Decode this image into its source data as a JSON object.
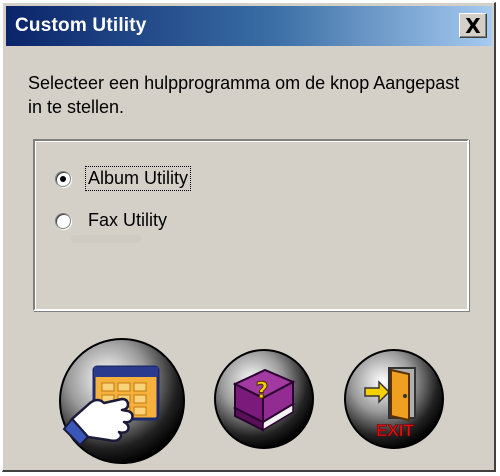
{
  "window": {
    "title": "Custom Utility",
    "close_glyph": "X"
  },
  "prompt": {
    "text": "Selecteer een hulpprogramma om de knop Aangepast in te stellen."
  },
  "options": {
    "items": [
      {
        "label": "Album Utility",
        "selected": true
      },
      {
        "label": "Fax Utility",
        "selected": false
      }
    ]
  },
  "buttons": {
    "album_icon": "hand-keypad-icon",
    "help_icon": "help-book-icon",
    "exit_icon": "exit-door-icon",
    "exit_text": "EXIT"
  },
  "colors": {
    "title_bar_start": "#0a246a",
    "title_bar_end": "#a6caf0",
    "face": "#d4d0c8"
  }
}
